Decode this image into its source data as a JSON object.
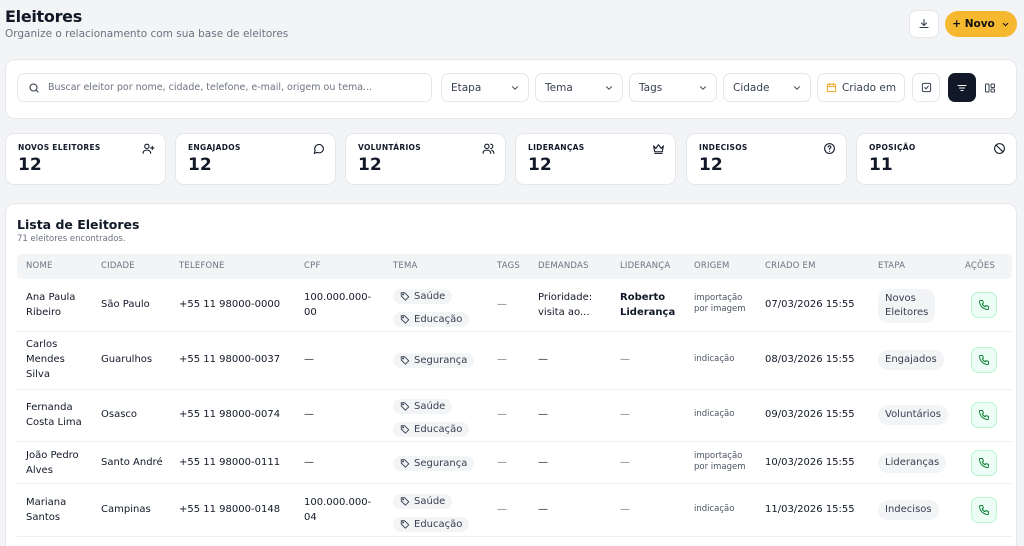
{
  "header": {
    "title": "Eleitores",
    "subtitle": "Organize o relacionamento com sua base de eleitores",
    "new_button": "+ Novo"
  },
  "filters": {
    "search_placeholder": "Buscar eleitor por nome, cidade, telefone, e-mail, origem ou tema...",
    "etapa": "Etapa",
    "tema": "Tema",
    "tags": "Tags",
    "cidade": "Cidade",
    "criado_em": "Criado em"
  },
  "stats": [
    {
      "label": "NOVOS ELEITORES",
      "value": "12",
      "icon": "user-plus-icon"
    },
    {
      "label": "ENGAJADOS",
      "value": "12",
      "icon": "chat-bubble-icon"
    },
    {
      "label": "VOLUNTÁRIOS",
      "value": "12",
      "icon": "users-icon"
    },
    {
      "label": "LIDERANÇAS",
      "value": "12",
      "icon": "crown-icon"
    },
    {
      "label": "INDECISOS",
      "value": "12",
      "icon": "question-circle-icon"
    },
    {
      "label": "OPOSIÇÃO",
      "value": "11",
      "icon": "ban-icon"
    }
  ],
  "list": {
    "title": "Lista de Eleitores",
    "count": "71 eleitores encontrados.",
    "columns": [
      "NOME",
      "CIDADE",
      "TELEFONE",
      "CPF",
      "TEMA",
      "TAGS",
      "DEMANDAS",
      "LIDERANÇA",
      "ORIGEM",
      "CRIADO EM",
      "ETAPA",
      "AÇÕES"
    ],
    "rows": [
      {
        "nome1": "Ana Paula",
        "nome2": "Ribeiro",
        "nome3": "",
        "cidade": "São Paulo",
        "telefone": "+55 11 98000-0000",
        "cpf1": "100.000.000-",
        "cpf2": "00",
        "tema1": "Saúde",
        "tema2": "Educação",
        "tags": "—",
        "dem1": "Prioridade:",
        "dem2": "visita ao...",
        "lid1": "Roberto",
        "lid2": "Liderança",
        "orig1": "importação",
        "orig2": "por imagem",
        "criado": "07/03/2026 15:55",
        "etapa1": "Novos",
        "etapa2": "Eleitores"
      },
      {
        "nome1": "Carlos",
        "nome2": "Mendes",
        "nome3": "Silva",
        "cidade": "Guarulhos",
        "telefone": "+55 11 98000-0037",
        "cpf1": "—",
        "cpf2": "",
        "tema1": "Segurança",
        "tema2": "",
        "tags": "—",
        "dem1": "—",
        "dem2": "",
        "lid1": "—",
        "lid2": "",
        "orig1": "indicação",
        "orig2": "",
        "criado": "08/03/2026 15:55",
        "etapa1": "Engajados",
        "etapa2": ""
      },
      {
        "nome1": "Fernanda",
        "nome2": "Costa Lima",
        "nome3": "",
        "cidade": "Osasco",
        "telefone": "+55 11 98000-0074",
        "cpf1": "—",
        "cpf2": "",
        "tema1": "Saúde",
        "tema2": "Educação",
        "tags": "—",
        "dem1": "—",
        "dem2": "",
        "lid1": "—",
        "lid2": "",
        "orig1": "indicação",
        "orig2": "",
        "criado": "09/03/2026 15:55",
        "etapa1": "Voluntários",
        "etapa2": ""
      },
      {
        "nome1": "João Pedro",
        "nome2": "Alves",
        "nome3": "",
        "cidade": "Santo André",
        "telefone": "+55 11 98000-0111",
        "cpf1": "—",
        "cpf2": "",
        "tema1": "Segurança",
        "tema2": "",
        "tags": "—",
        "dem1": "—",
        "dem2": "",
        "lid1": "—",
        "lid2": "",
        "orig1": "importação",
        "orig2": "por imagem",
        "criado": "10/03/2026 15:55",
        "etapa1": "Lideranças",
        "etapa2": ""
      },
      {
        "nome1": "Mariana",
        "nome2": "Santos",
        "nome3": "",
        "cidade": "Campinas",
        "telefone": "+55 11 98000-0148",
        "cpf1": "100.000.000-",
        "cpf2": "04",
        "tema1": "Saúde",
        "tema2": "Educação",
        "tags": "—",
        "dem1": "—",
        "dem2": "",
        "lid1": "—",
        "lid2": "",
        "orig1": "indicação",
        "orig2": "",
        "criado": "11/03/2026 15:55",
        "etapa1": "Indecisos",
        "etapa2": ""
      }
    ]
  }
}
